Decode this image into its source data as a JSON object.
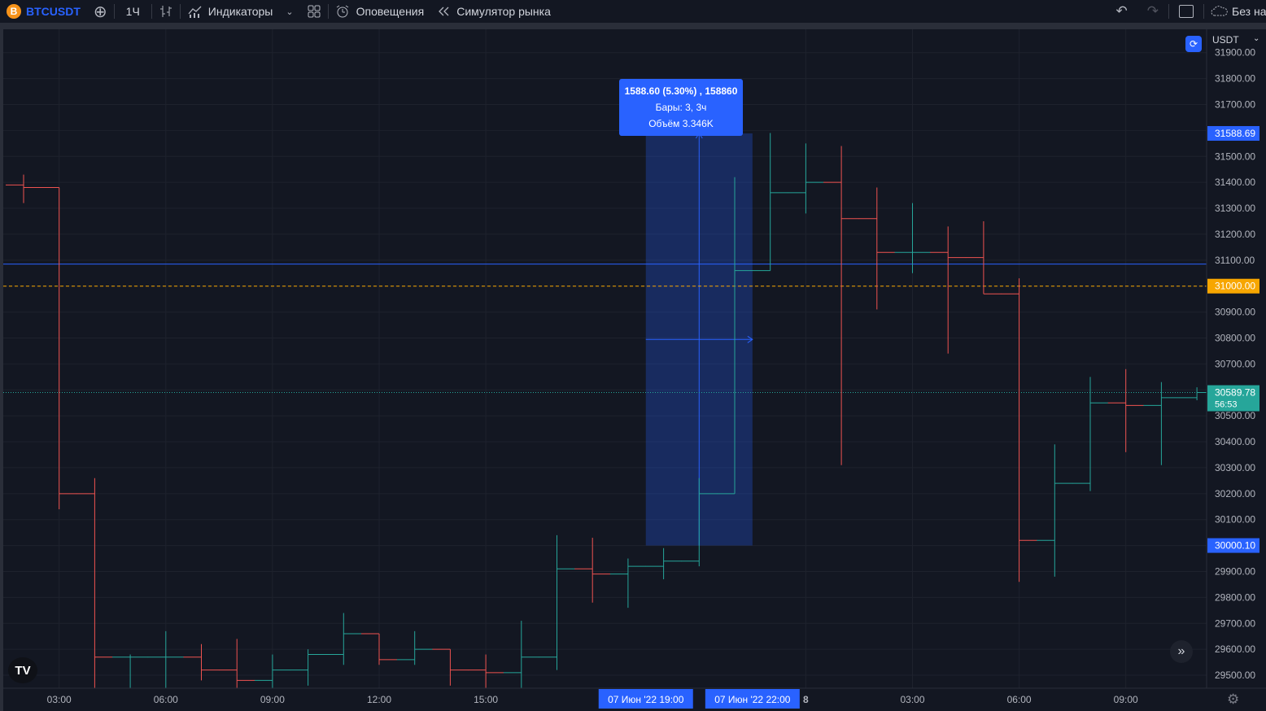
{
  "toolbar": {
    "coin_icon": "B",
    "symbol": "BTCUSDT",
    "add_icon": "⊕",
    "interval": "1Ч",
    "bar_style_icon": "bar-style-icon",
    "indicators_label": "Индикаторы",
    "layout_icon": "layout-icon",
    "alerts_label": "Оповещения",
    "replay_label": "Симулятор рынка",
    "undo_icon": "↶",
    "redo_icon": "↷",
    "layout_name": "Без назв"
  },
  "chart": {
    "currency": "USDT",
    "tooltip": {
      "line1": "1588.60 (5.30%) , 158860",
      "line2": "Бары: 3, 3ч",
      "line3": "Объём 3.346K"
    },
    "logo_text": "TV",
    "colors": {
      "up": "#26a69a",
      "down": "#ef5350",
      "accent": "#2962ff",
      "alert_line": "#f7a600",
      "last_price": "#26a69a"
    }
  },
  "chart_data": {
    "type": "ohlc",
    "interval": "1h",
    "ylim": [
      29450,
      31990
    ],
    "price_ticks": [
      "31900.00",
      "31800.00",
      "31700.00",
      "31600.00",
      "31500.00",
      "31400.00",
      "31300.00",
      "31200.00",
      "31100.00",
      "31000.00",
      "30900.00",
      "30800.00",
      "30700.00",
      "30600.00",
      "30500.00",
      "30400.00",
      "30300.00",
      "30200.00",
      "30100.00",
      "30000.00",
      "29900.00",
      "29800.00",
      "29700.00",
      "29600.00",
      "29500.00"
    ],
    "time_ticks": [
      {
        "label": "03:00",
        "bar": 1
      },
      {
        "label": "06:00",
        "bar": 4
      },
      {
        "label": "09:00",
        "bar": 7
      },
      {
        "label": "12:00",
        "bar": 10
      },
      {
        "label": "15:00",
        "bar": 13
      },
      {
        "label": "8",
        "bar": 22
      },
      {
        "label": "03:00",
        "bar": 25
      },
      {
        "label": "06:00",
        "bar": 28
      },
      {
        "label": "09:00",
        "bar": 31
      }
    ],
    "bars": [
      {
        "o": 31390,
        "h": 31430,
        "l": 31320,
        "c": 31380
      },
      {
        "o": 31380,
        "h": 31380,
        "l": 30140,
        "c": 30200
      },
      {
        "o": 30200,
        "h": 30260,
        "l": 29440,
        "c": 29570
      },
      {
        "o": 29570,
        "h": 29580,
        "l": 29440,
        "c": 29570
      },
      {
        "o": 29570,
        "h": 29670,
        "l": 29440,
        "c": 29570
      },
      {
        "o": 29570,
        "h": 29620,
        "l": 29480,
        "c": 29520
      },
      {
        "o": 29520,
        "h": 29640,
        "l": 29440,
        "c": 29480
      },
      {
        "o": 29480,
        "h": 29580,
        "l": 29440,
        "c": 29520
      },
      {
        "o": 29520,
        "h": 29600,
        "l": 29460,
        "c": 29580
      },
      {
        "o": 29580,
        "h": 29740,
        "l": 29540,
        "c": 29660
      },
      {
        "o": 29660,
        "h": 29660,
        "l": 29540,
        "c": 29560
      },
      {
        "o": 29560,
        "h": 29670,
        "l": 29540,
        "c": 29600
      },
      {
        "o": 29600,
        "h": 29600,
        "l": 29460,
        "c": 29520
      },
      {
        "o": 29520,
        "h": 29580,
        "l": 29450,
        "c": 29510
      },
      {
        "o": 29510,
        "h": 29710,
        "l": 29450,
        "c": 29570
      },
      {
        "o": 29570,
        "h": 30040,
        "l": 29520,
        "c": 29910
      },
      {
        "o": 29910,
        "h": 30030,
        "l": 29780,
        "c": 29890
      },
      {
        "o": 29890,
        "h": 29950,
        "l": 29760,
        "c": 29920
      },
      {
        "o": 29920,
        "h": 29990,
        "l": 29870,
        "c": 29940
      },
      {
        "o": 29940,
        "h": 30260,
        "l": 29920,
        "c": 30200
      },
      {
        "o": 30200,
        "h": 31420,
        "l": 30200,
        "c": 31060
      },
      {
        "o": 31060,
        "h": 31590,
        "l": 31060,
        "c": 31360
      },
      {
        "o": 31360,
        "h": 31550,
        "l": 31280,
        "c": 31400
      },
      {
        "o": 31400,
        "h": 31540,
        "l": 30310,
        "c": 31260
      },
      {
        "o": 31260,
        "h": 31380,
        "l": 30910,
        "c": 31130
      },
      {
        "o": 31130,
        "h": 31320,
        "l": 31050,
        "c": 31130
      },
      {
        "o": 31130,
        "h": 31230,
        "l": 30740,
        "c": 31110
      },
      {
        "o": 31110,
        "h": 31250,
        "l": 30970,
        "c": 30970
      },
      {
        "o": 30970,
        "h": 31030,
        "l": 29860,
        "c": 30020
      },
      {
        "o": 30020,
        "h": 30390,
        "l": 29880,
        "c": 30240
      },
      {
        "o": 30240,
        "h": 30650,
        "l": 30210,
        "c": 30550
      },
      {
        "o": 30550,
        "h": 30680,
        "l": 30360,
        "c": 30540
      },
      {
        "o": 30540,
        "h": 30630,
        "l": 30310,
        "c": 30570
      },
      {
        "o": 30570,
        "h": 30610,
        "l": 30560,
        "c": 30590
      }
    ],
    "horizontal_line": 31085,
    "alert_line": {
      "price": 31000,
      "label": "31000.00"
    },
    "last_price": {
      "price": 30589.78,
      "label": "30589.78",
      "countdown": "56:53"
    },
    "measure": {
      "from_bar": 17.5,
      "to_bar": 20.5,
      "low": 30000.1,
      "high": 31588.69,
      "low_label": "30000.10",
      "high_label": "31588.69"
    },
    "crosshair_dates": [
      {
        "label": "07 Июн '22   19:00",
        "bar": 17.5
      },
      {
        "label": "07 Июн '22   22:00",
        "bar": 20.5
      }
    ]
  }
}
